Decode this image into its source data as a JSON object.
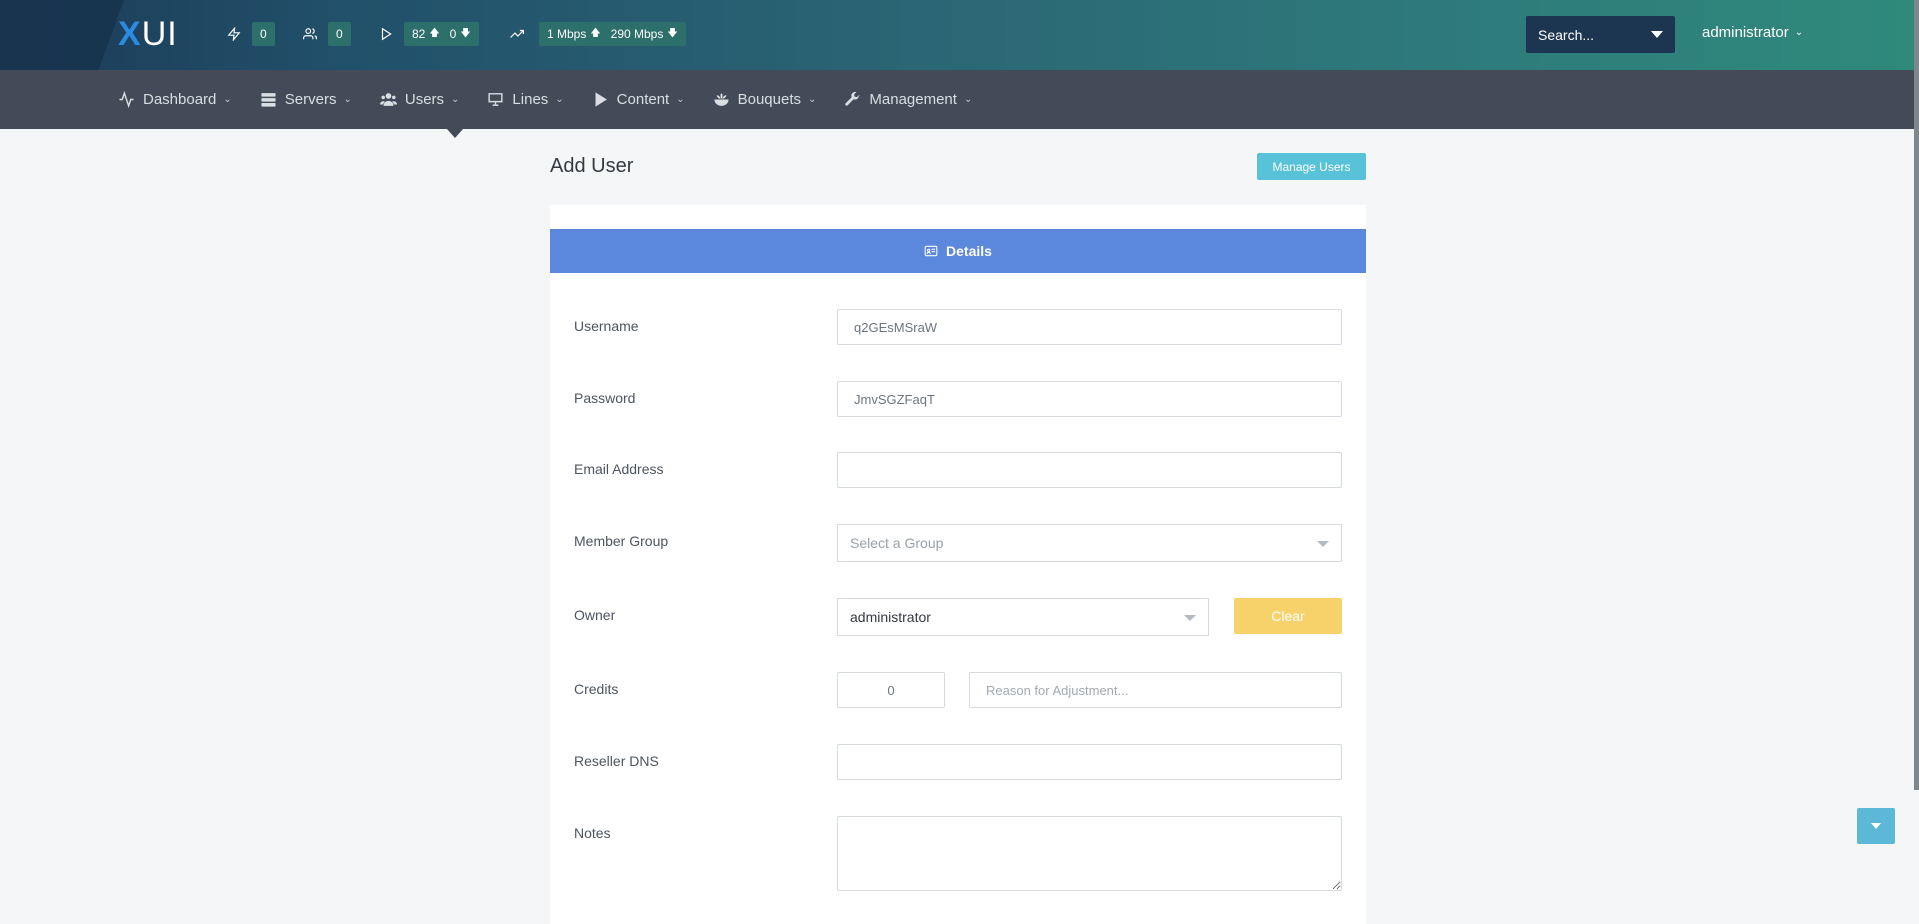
{
  "brand": {
    "logo_x": "X",
    "logo_ui": "UI"
  },
  "stats": {
    "connections": "0",
    "users": "0",
    "streams_up": "82",
    "streams_down": "0",
    "bandwidth_up": "1 Mbps",
    "bandwidth_down": "290 Mbps"
  },
  "header": {
    "search_placeholder": "Search...",
    "user": "administrator"
  },
  "nav": {
    "items": [
      {
        "label": "Dashboard",
        "icon": "activity-icon"
      },
      {
        "label": "Servers",
        "icon": "server-icon"
      },
      {
        "label": "Users",
        "icon": "users-icon"
      },
      {
        "label": "Lines",
        "icon": "monitor-icon"
      },
      {
        "label": "Content",
        "icon": "play-icon"
      },
      {
        "label": "Bouquets",
        "icon": "bouquet-icon"
      },
      {
        "label": "Management",
        "icon": "wrench-icon"
      }
    ]
  },
  "page": {
    "title": "Add User",
    "manage_button": "Manage Users",
    "tab_details": "Details"
  },
  "form": {
    "username_label": "Username",
    "username_value": "q2GEsMSraW",
    "password_label": "Password",
    "password_value": "JmvSGZFaqT",
    "email_label": "Email Address",
    "email_value": "",
    "group_label": "Member Group",
    "group_placeholder": "Select a Group",
    "owner_label": "Owner",
    "owner_value": "administrator",
    "clear_button": "Clear",
    "credits_label": "Credits",
    "credits_value": "0",
    "reason_placeholder": "Reason for Adjustment...",
    "dns_label": "Reseller DNS",
    "dns_value": "",
    "notes_label": "Notes",
    "notes_value": ""
  },
  "colors": {
    "accent": "#5b87dd",
    "info": "#58c2d9",
    "warning": "#f7d26b",
    "nav": "#424b57"
  }
}
